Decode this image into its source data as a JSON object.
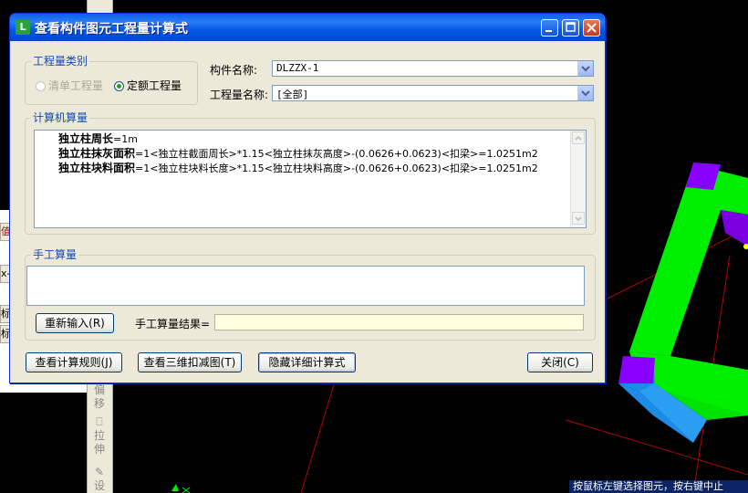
{
  "dialog": {
    "title": "查看构件图元工程量计算式",
    "app_icon": "green-app-icon"
  },
  "quantity_type": {
    "title": "工程量类别",
    "options": [
      "清单工程量",
      "定额工程量"
    ],
    "selected": "定额工程量"
  },
  "component": {
    "name_label": "构件名称:",
    "name_value": "DLZZX-1",
    "qty_label": "工程量名称:",
    "qty_value": "[全部]"
  },
  "computer_calc": {
    "title": "计算机算量",
    "lines": [
      {
        "name": "独立柱周长",
        "expr": "=1m"
      },
      {
        "name": "独立柱抹灰面积",
        "expr": "=1<独立柱截面周长>*1.15<独立柱抹灰高度>-(0.0626+0.0623)<扣梁>=1.0251m2"
      },
      {
        "name": "独立柱块料面积",
        "expr": "=1<独立柱块料长度>*1.15<独立柱块料高度>-(0.0626+0.0623)<扣梁>=1.0251m2"
      }
    ]
  },
  "manual_calc": {
    "title": "手工算量",
    "reenter_button": "重新输入(R)",
    "result_label": "手工算量结果=",
    "result_value": ""
  },
  "buttons": {
    "rules": "查看计算规则(J)",
    "view3d": "查看三维扣减图(T)",
    "hide_detail": "隐藏详细计算式",
    "close": "关闭(C)"
  },
  "background": {
    "toolbar_tools": [
      "偏移",
      "拉伸",
      "设"
    ],
    "left_strips": [
      "值",
      "x-",
      "标",
      "标"
    ],
    "status_text": "按鼠标左键选择图元，按右键中止",
    "beam_colors": {
      "green": "#00ee00",
      "purple": "#8a00ff",
      "blue": "#1c8ce8",
      "grid": "#d00000"
    }
  }
}
